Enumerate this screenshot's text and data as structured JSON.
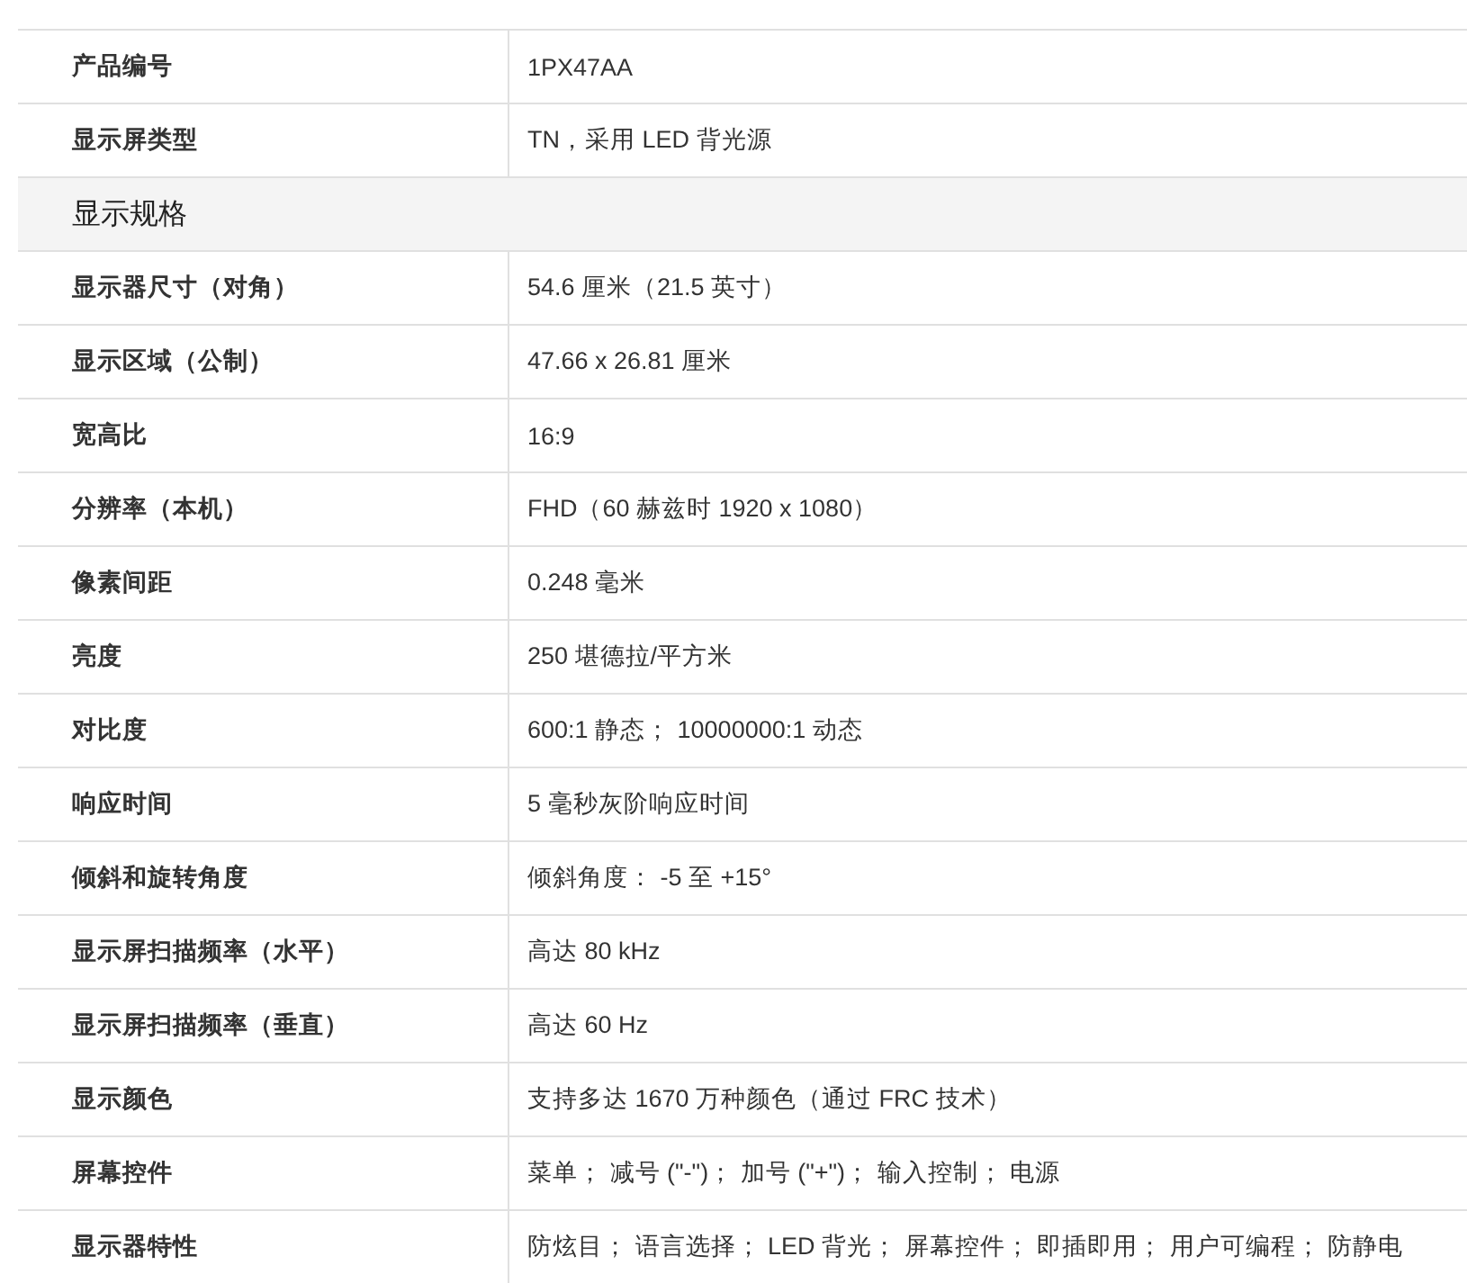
{
  "rows": [
    {
      "kind": "row",
      "label": "产品编号",
      "value": "1PX47AA"
    },
    {
      "kind": "row",
      "label": "显示屏类型",
      "value": "TN，采用 LED 背光源"
    },
    {
      "kind": "section",
      "label": "显示规格"
    },
    {
      "kind": "row",
      "label": "显示器尺寸（对角）",
      "value": "54.6 厘米（21.5 英寸）"
    },
    {
      "kind": "row",
      "label": "显示区域（公制）",
      "value": "47.66 x 26.81 厘米"
    },
    {
      "kind": "row",
      "label": "宽高比",
      "value": "16:9"
    },
    {
      "kind": "row",
      "label": "分辨率（本机）",
      "value": "FHD（60 赫兹时 1920 x 1080）"
    },
    {
      "kind": "row",
      "label": "像素间距",
      "value": "0.248 毫米"
    },
    {
      "kind": "row",
      "label": "亮度",
      "value": "250 堪德拉/平方米"
    },
    {
      "kind": "row",
      "label": "对比度",
      "value": "600:1 静态； 10000000:1 动态"
    },
    {
      "kind": "row",
      "label": "响应时间",
      "value": "5 毫秒灰阶响应时间"
    },
    {
      "kind": "row",
      "label": "倾斜和旋转角度",
      "value": "倾斜角度： -5 至 +15°"
    },
    {
      "kind": "row",
      "label": "显示屏扫描频率（水平）",
      "value": "高达 80 kHz"
    },
    {
      "kind": "row",
      "label": "显示屏扫描频率（垂直）",
      "value": "高达 60 Hz"
    },
    {
      "kind": "row",
      "label": "显示颜色",
      "value": "支持多达 1670 万种颜色（通过 FRC 技术）"
    },
    {
      "kind": "row",
      "label": "屏幕控件",
      "value": "菜单； 减号 (\"-\")； 加号 (\"+\")； 输入控制； 电源"
    },
    {
      "kind": "row",
      "label": "显示器特性",
      "value": "防炫目； 语言选择； LED 背光； 屏幕控件； 即插即用； 用户可编程； 防静电"
    }
  ]
}
